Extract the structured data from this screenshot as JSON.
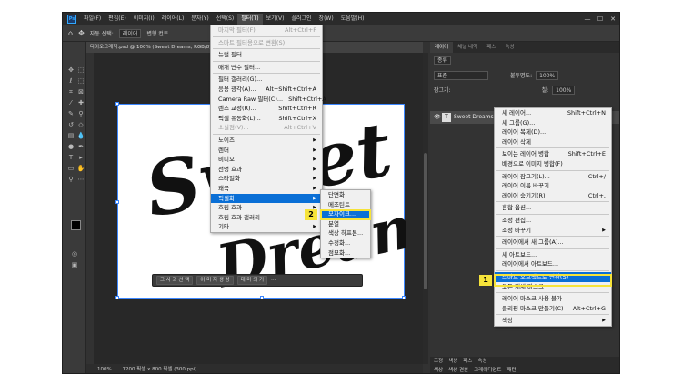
{
  "app": {
    "logo": "Ps",
    "menus": [
      "파일(F)",
      "편집(E)",
      "이미지(I)",
      "레이어(L)",
      "문자(Y)",
      "선택(S)",
      "필터(T)",
      "보기(V)",
      "플러그인",
      "창(W)",
      "도움말(H)"
    ],
    "active_menu_index": 6,
    "window_controls": [
      "—",
      "☐",
      "✕"
    ]
  },
  "options_bar": {
    "auto_select_label": "자동 선택:",
    "auto_select_value": "레이어",
    "transform_label": "변형 컨트"
  },
  "document": {
    "tab_title": "다이오그래픽.psd @ 100% (Sweet Dreams, RGB/8)",
    "zoom": "100%",
    "doc_info": "1200 픽셀 x 800 픽셀 (300 ppi)"
  },
  "artwork": {
    "line1": "Sweet",
    "line2": "Dreams"
  },
  "context_bar": {
    "buttons": [
      "그 사 과 선 택",
      "이 미 지 생 성",
      "테 마 의 기",
      "⋯"
    ]
  },
  "filter_menu": {
    "items": [
      {
        "label": "마지막 필터(F)",
        "shortcut": "Alt+Ctrl+F",
        "disabled": true
      },
      {
        "sep": true
      },
      {
        "label": "스마트 필터용으로 변환(S)",
        "shortcut": "",
        "disabled": true
      },
      {
        "sep": true
      },
      {
        "label": "뉴럴 필터...",
        "shortcut": ""
      },
      {
        "sep": true
      },
      {
        "label": "매개 변수 필터...",
        "shortcut": ""
      },
      {
        "sep": true
      },
      {
        "label": "필터 갤러리(G)...",
        "shortcut": ""
      },
      {
        "label": "응용 광각(A)...",
        "shortcut": "Alt+Shift+Ctrl+A"
      },
      {
        "label": "Camera Raw 필터(C)...",
        "shortcut": "Shift+Ctrl+A"
      },
      {
        "label": "렌즈 교정(R)...",
        "shortcut": "Shift+Ctrl+R"
      },
      {
        "label": "픽셀 유동화(L)...",
        "shortcut": "Shift+Ctrl+X"
      },
      {
        "label": "소실점(V)...",
        "shortcut": "Alt+Ctrl+V",
        "disabled": true
      },
      {
        "sep": true
      },
      {
        "label": "노이즈",
        "shortcut": "",
        "sub": true
      },
      {
        "label": "렌더",
        "shortcut": "",
        "sub": true
      },
      {
        "label": "비디오",
        "shortcut": "",
        "sub": true
      },
      {
        "label": "선명 효과",
        "shortcut": "",
        "sub": true
      },
      {
        "label": "스타일화",
        "shortcut": "",
        "sub": true
      },
      {
        "label": "왜곡",
        "shortcut": "",
        "sub": true
      },
      {
        "label": "픽셀화",
        "shortcut": "",
        "sub": true,
        "highlight": true
      },
      {
        "label": "흐림 효과",
        "shortcut": "",
        "sub": true
      },
      {
        "label": "흐림 효과 갤러리",
        "shortcut": "",
        "sub": true
      },
      {
        "label": "기타",
        "shortcut": "",
        "sub": true
      }
    ]
  },
  "pixelate_menu": {
    "items": [
      {
        "label": "단면화"
      },
      {
        "label": "메조틴트"
      },
      {
        "label": "모자이크...",
        "highlight": true
      },
      {
        "label": "분열"
      },
      {
        "label": "색상 하프톤..."
      },
      {
        "label": "수정화..."
      },
      {
        "label": "점묘화..."
      }
    ]
  },
  "layers_panel": {
    "tabs": [
      "레이어",
      "채널 내역",
      "패스",
      "속성"
    ],
    "filter_label": "종류",
    "blend_mode": "표준",
    "opacity_label": "불투명도:",
    "opacity_value": "100%",
    "lock_label": "잠그기:",
    "fill_label": "칠:",
    "fill_value": "100%",
    "layer_name": "Sweet Dreams",
    "bottom_tabs": [
      "조정",
      "색상",
      "패스",
      "속성"
    ],
    "bottom_tabs2": [
      "색상",
      "색상 견본",
      "그레이디언트",
      "패턴"
    ]
  },
  "layer_context_menu": {
    "items": [
      {
        "label": "새 레이어...",
        "shortcut": "Shift+Ctrl+N"
      },
      {
        "label": "새 그룹(G)...",
        "shortcut": ""
      },
      {
        "label": "레이어 복제(D)...",
        "shortcut": ""
      },
      {
        "label": "레이어 삭제",
        "shortcut": ""
      },
      {
        "sep": true
      },
      {
        "label": "보이는 레이어 병합",
        "shortcut": "Shift+Ctrl+E"
      },
      {
        "label": "배경으로 이미지 병합(F)",
        "shortcut": ""
      },
      {
        "sep": true
      },
      {
        "label": "레이어 잠그기(L)...",
        "shortcut": "Ctrl+/"
      },
      {
        "label": "레이어 이름 바꾸기...",
        "shortcut": ""
      },
      {
        "label": "레이어 숨기기(R)",
        "shortcut": "Ctrl+,"
      },
      {
        "sep": true
      },
      {
        "label": "혼합 옵션...",
        "shortcut": ""
      },
      {
        "sep": true
      },
      {
        "label": "조정 편집...",
        "shortcut": ""
      },
      {
        "label": "조정 바꾸기",
        "shortcut": "",
        "sub": true
      },
      {
        "sep": true
      },
      {
        "label": "레이어에서 새 그룹(A)...",
        "shortcut": ""
      },
      {
        "sep": true
      },
      {
        "label": "새 아트보드...",
        "shortcut": ""
      },
      {
        "label": "레이어에서 아트보드...",
        "shortcut": ""
      },
      {
        "sep": true
      },
      {
        "label": "스마트 오브젝트로 변환(S)",
        "shortcut": "",
        "highlight": true
      },
      {
        "label": "모든 개체 마스크",
        "shortcut": ""
      },
      {
        "sep": true
      },
      {
        "label": "레이어 마스크 사용 불가",
        "shortcut": ""
      },
      {
        "label": "클리핑 마스크 만들기(C)",
        "shortcut": "Alt+Ctrl+G"
      },
      {
        "sep": true
      },
      {
        "label": "색상",
        "shortcut": "",
        "sub": true
      }
    ]
  },
  "markers": [
    "1",
    "2"
  ],
  "colors": {
    "highlight": "#0a6fd6",
    "marker": "#f6e33a",
    "selection": "#3c87ff"
  }
}
